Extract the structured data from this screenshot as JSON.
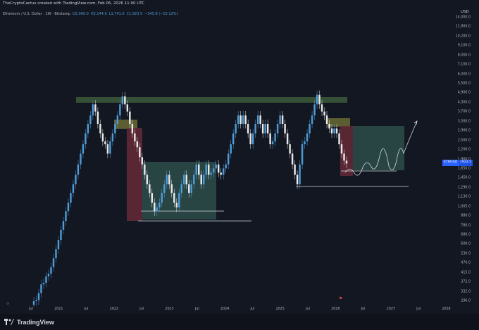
{
  "header": {
    "author_line": "TheCryptoCactus created with TradingView.com, Feb 06, 2026 11:00 UTC",
    "symbol": "Ethereum / U.S. Dollar · 1W · Bitstamp",
    "ohlc": [
      "O2,060.0",
      "H2,144.0",
      "L1,741.0",
      "C1,923.5",
      "−345.8 (−15.13%)"
    ]
  },
  "axis": {
    "currency": "USD",
    "price_labels": [
      "14,000.0",
      "11,900.0",
      "10,200.0",
      "9,100.0",
      "8,000.0",
      "7,100.0",
      "6,300.0",
      "5,500.0",
      "4,900.0",
      "4,300.0",
      "3,700.0",
      "3,300.0",
      "2,900.0",
      "2,500.0",
      "2,200.0",
      "1,900.0",
      "1,650.0",
      "1,450.0",
      "1,290.0",
      "1,130.0",
      "1,005.0",
      "880.0",
      "780.0",
      "680.0",
      "600.0",
      "530.0",
      "470.0",
      "415.0",
      "372.0",
      "332.0",
      "296.0"
    ],
    "time_labels": [
      "Jul",
      "2021",
      "Jul",
      "2022",
      "Jul",
      "2023",
      "Jul",
      "2024",
      "Jul",
      "2025",
      "Jul",
      "2026",
      "Jul",
      "2027",
      "Jul",
      "2028"
    ]
  },
  "badge": {
    "symbol": "ETHUSD",
    "price": "1923.5"
  },
  "footer": {
    "brand": "TradingView"
  },
  "colors": {
    "bg": "#131722",
    "up": "#4e9bd6",
    "down": "#e8e8e8",
    "resistance": "#3d5a3c",
    "sell_zone": "#6b2a38",
    "buy_zone": "#2d4d4a",
    "decision": "#6b6a35"
  },
  "chart_data": {
    "type": "candlestick",
    "series": [
      {
        "close": [
          296,
          300,
          330,
          372,
          380,
          415,
          430,
          470,
          530,
          600,
          680,
          780,
          880,
          1005,
          1130,
          1290,
          1450,
          1650,
          1900,
          2200,
          2500,
          2900,
          3300,
          3700,
          4300,
          3900,
          3300,
          2900,
          2600,
          2500,
          2200,
          2600,
          2900,
          3300,
          3700,
          4300,
          4800,
          4300,
          3900,
          3300,
          2900,
          2600,
          2400,
          2100,
          1900,
          1650,
          1450,
          1290,
          1130,
          1005,
          1060,
          1130,
          1290,
          1450,
          1650,
          1450,
          1290,
          1130,
          1060,
          1290,
          1450,
          1650,
          1450,
          1290,
          1450,
          1650,
          1900,
          1650,
          1450,
          1650,
          1900,
          1650,
          1700,
          1800,
          1900,
          1700,
          1650,
          1800,
          1900,
          2200,
          2500,
          2900,
          3300,
          3700,
          3300,
          3700,
          3300,
          2900,
          2500,
          2900,
          3300,
          3700,
          3300,
          2900,
          3300,
          2900,
          2500,
          2600,
          2900,
          3300,
          3700,
          3300,
          2900,
          2500,
          2200,
          1900,
          1650,
          1450,
          1900,
          2500,
          2600,
          2900,
          3300,
          3700,
          4300,
          4900,
          4300,
          3900,
          3700,
          3300,
          3100,
          2900,
          3100,
          2900,
          2500,
          2200,
          2000,
          1923.5
        ]
      }
    ]
  }
}
